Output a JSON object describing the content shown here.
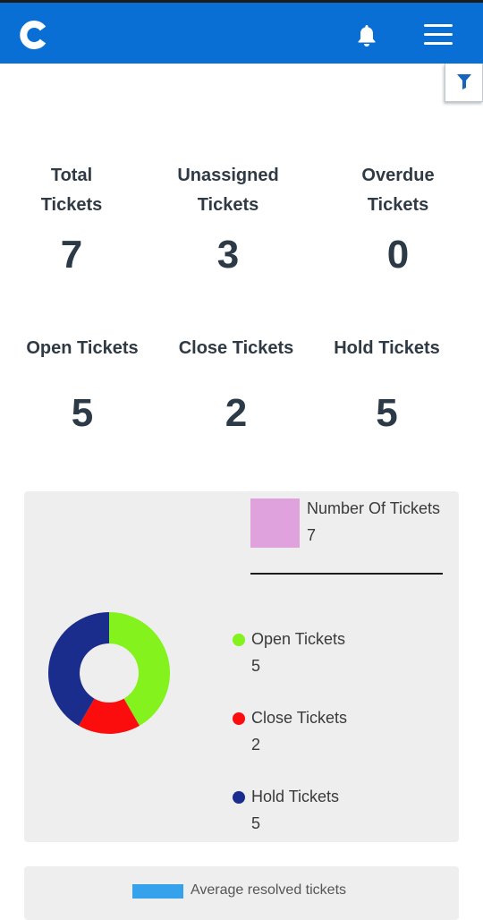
{
  "stats": [
    {
      "label_line1": "Total",
      "label_line2": "Tickets",
      "value": "7"
    },
    {
      "label_line1": "Unassigned",
      "label_line2": "Tickets",
      "value": "3"
    },
    {
      "label_line1": "Overdue",
      "label_line2": "Tickets",
      "value": "0"
    },
    {
      "label": "Open Tickets",
      "value": "5"
    },
    {
      "label": "Close Tickets",
      "value": "2"
    },
    {
      "label": "Hold Tickets",
      "value": "5"
    }
  ],
  "chart_data": {
    "type": "pie",
    "title": "Number Of Tickets",
    "total": 7,
    "categories": [
      "Open Tickets",
      "Close Tickets",
      "Hold Tickets"
    ],
    "values": [
      5,
      2,
      5
    ],
    "colors": [
      "#84f21c",
      "#fc0d0d",
      "#1a2d8c"
    ],
    "header_color": "#dfa2dd"
  },
  "legend": {
    "title": "Number Of Tickets",
    "value": "7",
    "items": [
      {
        "label": "Open Tickets",
        "value": "5",
        "color": "#84f21c"
      },
      {
        "label": "Close Tickets",
        "value": "2",
        "color": "#fc0d0d"
      },
      {
        "label": "Hold Tickets",
        "value": "5",
        "color": "#1a2d8c"
      }
    ]
  },
  "second_chart": {
    "legend_label": "Average resolved tickets",
    "color": "#36a2eb"
  },
  "icons": {
    "logo": "logo-icon",
    "notifications": "bell-icon",
    "menu": "hamburger-icon",
    "filter": "filter-icon"
  },
  "colors": {
    "header": "#0a6fd4",
    "card": "#eeeeee"
  }
}
